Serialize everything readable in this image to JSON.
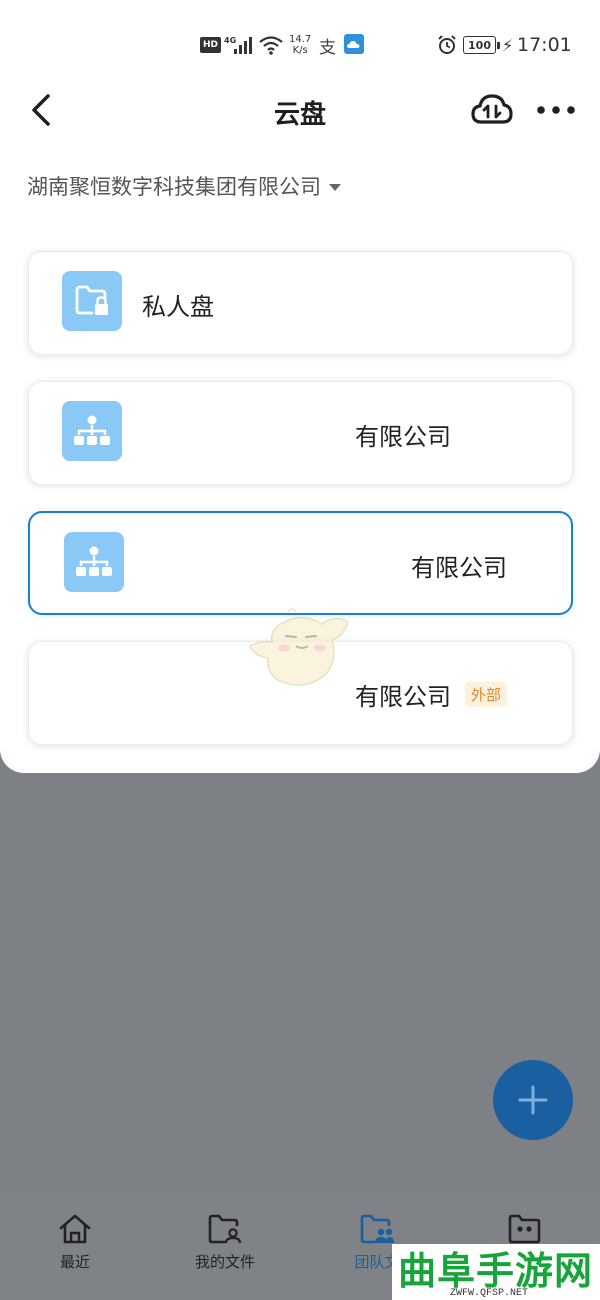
{
  "status_bar": {
    "hd": "HD",
    "network": "4G",
    "speed_value": "14.7",
    "speed_unit": "K/s",
    "alipay": "支",
    "battery": "100",
    "time": "17:01"
  },
  "header": {
    "title": "云盘"
  },
  "org_selector": {
    "name": "湖南聚恒数字科技集团有限公司"
  },
  "cards": [
    {
      "label": "私人盘",
      "icon": "folder-lock-icon"
    },
    {
      "label": "有限公司",
      "icon": "org-chart-icon"
    },
    {
      "label": "有限公司",
      "icon": "org-chart-icon",
      "selected": true
    },
    {
      "label": "有限公司",
      "badge": "外部"
    }
  ],
  "bottom_nav": {
    "items": [
      {
        "label": "最近",
        "icon": "home-icon"
      },
      {
        "label": "我的文件",
        "icon": "my-files-icon"
      },
      {
        "label": "团队文",
        "icon": "team-files-icon",
        "active": true
      },
      {
        "label": "",
        "icon": "shared-folder-icon"
      }
    ]
  },
  "watermark": {
    "main": "曲阜手游网",
    "sub": "ZWFW.QFSP.NET"
  },
  "colors": {
    "accent": "#1a7fd4",
    "fab": "#1a5fa0",
    "card_icon_bg": "#8ac8f6",
    "badge_text": "#d98b2a",
    "overlay": "#7d8186"
  }
}
